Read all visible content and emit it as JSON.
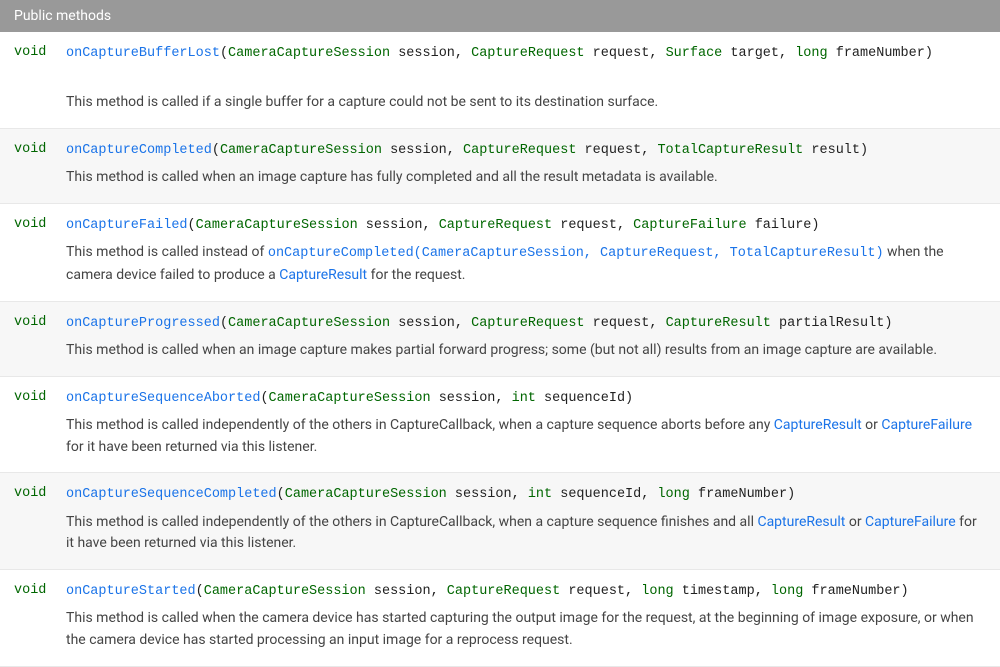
{
  "header": "Public methods",
  "methods": [
    {
      "return": "void",
      "sig": [
        {
          "t": "method",
          "v": "onCaptureBufferLost",
          "href": true
        },
        {
          "t": "punct",
          "v": "("
        },
        {
          "t": "type",
          "v": "CameraCaptureSession",
          "href": true
        },
        {
          "t": "punct",
          "v": " "
        },
        {
          "t": "param",
          "v": "session"
        },
        {
          "t": "punct",
          "v": ", "
        },
        {
          "t": "type",
          "v": "CaptureRequest",
          "href": true
        },
        {
          "t": "punct",
          "v": " "
        },
        {
          "t": "param",
          "v": "request"
        },
        {
          "t": "punct",
          "v": ", "
        },
        {
          "t": "type",
          "v": "Surface",
          "href": true
        },
        {
          "t": "punct",
          "v": " "
        },
        {
          "t": "param",
          "v": "target"
        },
        {
          "t": "punct",
          "v": ", "
        },
        {
          "t": "keyword",
          "v": "long"
        },
        {
          "t": "punct",
          "v": " "
        },
        {
          "t": "param",
          "v": "frameNumber"
        },
        {
          "t": "punct",
          "v": ")"
        }
      ],
      "desc": [
        {
          "t": "text",
          "v": "This method is called if a single buffer for a capture could not be sent to its destination surface."
        }
      ]
    },
    {
      "return": "void",
      "sig": [
        {
          "t": "method",
          "v": "onCaptureCompleted",
          "href": true
        },
        {
          "t": "punct",
          "v": "("
        },
        {
          "t": "type",
          "v": "CameraCaptureSession",
          "href": true
        },
        {
          "t": "punct",
          "v": " "
        },
        {
          "t": "param",
          "v": "session"
        },
        {
          "t": "punct",
          "v": ", "
        },
        {
          "t": "type",
          "v": "CaptureRequest",
          "href": true
        },
        {
          "t": "punct",
          "v": " "
        },
        {
          "t": "param",
          "v": "request"
        },
        {
          "t": "punct",
          "v": ", "
        },
        {
          "t": "type",
          "v": "TotalCaptureResult",
          "href": true
        },
        {
          "t": "punct",
          "v": " "
        },
        {
          "t": "param",
          "v": "result"
        },
        {
          "t": "punct",
          "v": ")"
        }
      ],
      "desc": [
        {
          "t": "text",
          "v": "This method is called when an image capture has fully completed and all the result metadata is available."
        }
      ]
    },
    {
      "return": "void",
      "sig": [
        {
          "t": "method",
          "v": "onCaptureFailed",
          "href": true
        },
        {
          "t": "punct",
          "v": "("
        },
        {
          "t": "type",
          "v": "CameraCaptureSession",
          "href": true
        },
        {
          "t": "punct",
          "v": " "
        },
        {
          "t": "param",
          "v": "session"
        },
        {
          "t": "punct",
          "v": ", "
        },
        {
          "t": "type",
          "v": "CaptureRequest",
          "href": true
        },
        {
          "t": "punct",
          "v": " "
        },
        {
          "t": "param",
          "v": "request"
        },
        {
          "t": "punct",
          "v": ", "
        },
        {
          "t": "type",
          "v": "CaptureFailure",
          "href": true
        },
        {
          "t": "punct",
          "v": " "
        },
        {
          "t": "param",
          "v": "failure"
        },
        {
          "t": "punct",
          "v": ")"
        }
      ],
      "desc": [
        {
          "t": "text",
          "v": "This method is called instead of "
        },
        {
          "t": "methodref",
          "v": "onCaptureCompleted(CameraCaptureSession, CaptureRequest, TotalCaptureResult)",
          "href": true
        },
        {
          "t": "text",
          "v": " when the camera device failed to produce a "
        },
        {
          "t": "link",
          "v": "CaptureResult",
          "href": true
        },
        {
          "t": "text",
          "v": " for the request."
        }
      ]
    },
    {
      "return": "void",
      "sig": [
        {
          "t": "method",
          "v": "onCaptureProgressed",
          "href": true
        },
        {
          "t": "punct",
          "v": "("
        },
        {
          "t": "type",
          "v": "CameraCaptureSession",
          "href": true
        },
        {
          "t": "punct",
          "v": " "
        },
        {
          "t": "param",
          "v": "session"
        },
        {
          "t": "punct",
          "v": ", "
        },
        {
          "t": "type",
          "v": "CaptureRequest",
          "href": true
        },
        {
          "t": "punct",
          "v": " "
        },
        {
          "t": "param",
          "v": "request"
        },
        {
          "t": "punct",
          "v": ", "
        },
        {
          "t": "type",
          "v": "CaptureResult",
          "href": true
        },
        {
          "t": "punct",
          "v": " "
        },
        {
          "t": "param",
          "v": "partialResult"
        },
        {
          "t": "punct",
          "v": ")"
        }
      ],
      "desc": [
        {
          "t": "text",
          "v": "This method is called when an image capture makes partial forward progress; some (but not all) results from an image capture are available."
        }
      ]
    },
    {
      "return": "void",
      "sig": [
        {
          "t": "method",
          "v": "onCaptureSequenceAborted",
          "href": true
        },
        {
          "t": "punct",
          "v": "("
        },
        {
          "t": "type",
          "v": "CameraCaptureSession",
          "href": true
        },
        {
          "t": "punct",
          "v": " "
        },
        {
          "t": "param",
          "v": "session"
        },
        {
          "t": "punct",
          "v": ", "
        },
        {
          "t": "keyword",
          "v": "int"
        },
        {
          "t": "punct",
          "v": " "
        },
        {
          "t": "param",
          "v": "sequenceId"
        },
        {
          "t": "punct",
          "v": ")"
        }
      ],
      "desc": [
        {
          "t": "text",
          "v": "This method is called independently of the others in CaptureCallback, when a capture sequence aborts before any "
        },
        {
          "t": "link",
          "v": "CaptureResult",
          "href": true
        },
        {
          "t": "text",
          "v": " or "
        },
        {
          "t": "link",
          "v": "CaptureFailure",
          "href": true
        },
        {
          "t": "text",
          "v": " for it have been returned via this listener."
        }
      ]
    },
    {
      "return": "void",
      "sig": [
        {
          "t": "method",
          "v": "onCaptureSequenceCompleted",
          "href": true
        },
        {
          "t": "punct",
          "v": "("
        },
        {
          "t": "type",
          "v": "CameraCaptureSession",
          "href": true
        },
        {
          "t": "punct",
          "v": " "
        },
        {
          "t": "param",
          "v": "session"
        },
        {
          "t": "punct",
          "v": ", "
        },
        {
          "t": "keyword",
          "v": "int"
        },
        {
          "t": "punct",
          "v": " "
        },
        {
          "t": "param",
          "v": "sequenceId"
        },
        {
          "t": "punct",
          "v": ", "
        },
        {
          "t": "keyword",
          "v": "long"
        },
        {
          "t": "punct",
          "v": " "
        },
        {
          "t": "param",
          "v": "frameNumber"
        },
        {
          "t": "punct",
          "v": ")"
        }
      ],
      "desc": [
        {
          "t": "text",
          "v": "This method is called independently of the others in CaptureCallback, when a capture sequence finishes and all "
        },
        {
          "t": "link",
          "v": "CaptureResult",
          "href": true
        },
        {
          "t": "text",
          "v": " or "
        },
        {
          "t": "link",
          "v": "CaptureFailure",
          "href": true
        },
        {
          "t": "text",
          "v": " for it have been returned via this listener."
        }
      ]
    },
    {
      "return": "void",
      "sig": [
        {
          "t": "method",
          "v": "onCaptureStarted",
          "href": true
        },
        {
          "t": "punct",
          "v": "("
        },
        {
          "t": "type",
          "v": "CameraCaptureSession",
          "href": true
        },
        {
          "t": "punct",
          "v": " "
        },
        {
          "t": "param",
          "v": "session"
        },
        {
          "t": "punct",
          "v": ", "
        },
        {
          "t": "type",
          "v": "CaptureRequest",
          "href": true
        },
        {
          "t": "punct",
          "v": " "
        },
        {
          "t": "param",
          "v": "request"
        },
        {
          "t": "punct",
          "v": ", "
        },
        {
          "t": "keyword",
          "v": "long"
        },
        {
          "t": "punct",
          "v": " "
        },
        {
          "t": "param",
          "v": "timestamp"
        },
        {
          "t": "punct",
          "v": ", "
        },
        {
          "t": "keyword",
          "v": "long"
        },
        {
          "t": "punct",
          "v": " "
        },
        {
          "t": "param",
          "v": "frameNumber"
        },
        {
          "t": "punct",
          "v": ")"
        }
      ],
      "desc": [
        {
          "t": "text",
          "v": "This method is called when the camera device has started capturing the output image for the request, at the beginning of image exposure, or when the camera device has started processing an input image for a reprocess request."
        }
      ]
    }
  ]
}
